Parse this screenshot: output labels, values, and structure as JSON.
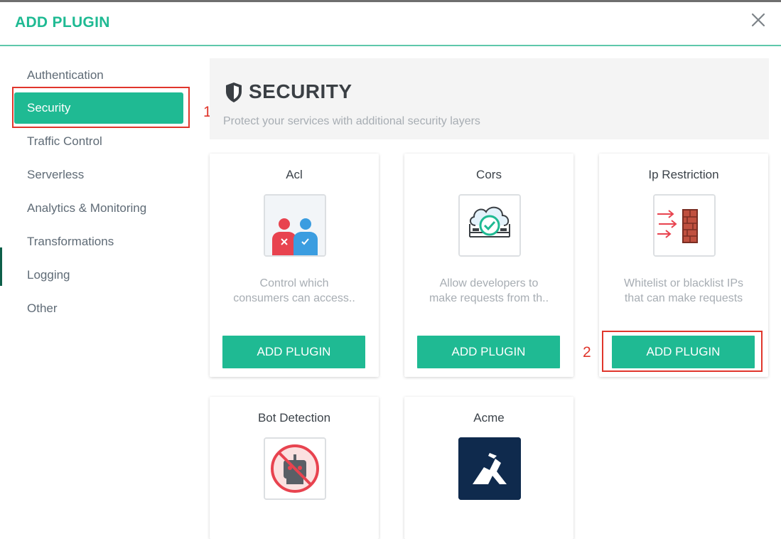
{
  "dialog": {
    "title": "ADD PLUGIN",
    "close_icon": "close-icon"
  },
  "sidebar": {
    "items": [
      {
        "label": "Authentication",
        "active": false
      },
      {
        "label": "Security",
        "active": true
      },
      {
        "label": "Traffic Control",
        "active": false
      },
      {
        "label": "Serverless",
        "active": false
      },
      {
        "label": "Analytics & Monitoring",
        "active": false
      },
      {
        "label": "Transformations",
        "active": false
      },
      {
        "label": "Logging",
        "active": false
      },
      {
        "label": "Other",
        "active": false
      }
    ]
  },
  "annotations": {
    "one": "1",
    "two": "2"
  },
  "section": {
    "icon": "shield-icon",
    "title": "SECURITY",
    "subtitle": "Protect your services with additional security layers"
  },
  "plugins": [
    {
      "name": "Acl",
      "icon": "users-icon",
      "description_line1": "Control which",
      "description_line2": "consumers can access..",
      "button": "ADD PLUGIN"
    },
    {
      "name": "Cors",
      "icon": "cloud-check-icon",
      "description_line1": "Allow developers to",
      "description_line2": "make requests from th..",
      "button": "ADD PLUGIN"
    },
    {
      "name": "Ip Restriction",
      "icon": "firewall-icon",
      "description_line1": "Whitelist or blacklist IPs",
      "description_line2": "that can make requests",
      "button": "ADD PLUGIN"
    },
    {
      "name": "Bot Detection",
      "icon": "robot-blocked-icon"
    },
    {
      "name": "Acme",
      "icon": "kong-logo-icon"
    }
  ],
  "colors": {
    "accent": "#1fba93",
    "annotation": "#e0362c",
    "text_muted": "#a7adb3"
  }
}
